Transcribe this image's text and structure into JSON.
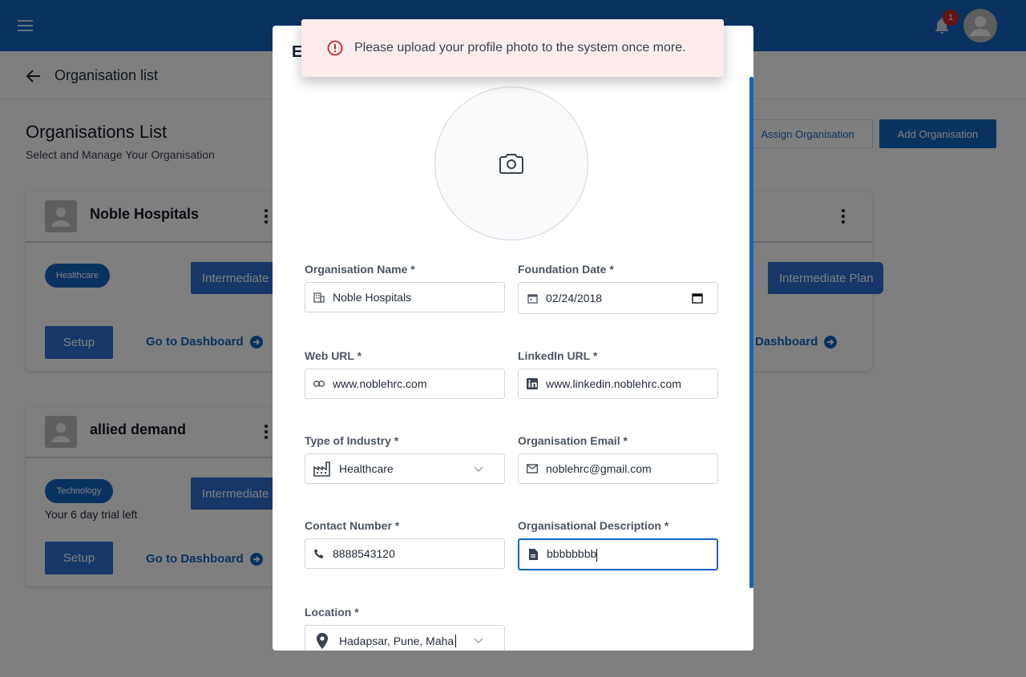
{
  "header": {
    "notification_count": "1"
  },
  "breadcrumb": {
    "label": "Organisation list"
  },
  "page": {
    "title": "Organisations List",
    "subtitle": "Select and Manage Your Organisation",
    "assign_label": "Assign Organisation",
    "add_label": "Add Organisation"
  },
  "cards": [
    {
      "name": "Noble Hospitals",
      "industry": "Healthcare",
      "plan": "Intermediate Plan",
      "setup": "Setup",
      "dashboard": "Go to Dashboard"
    },
    {
      "name": "allied demand",
      "industry": "Technology",
      "plan": "Intermediate Plan",
      "trial": "Your 6 day trial left",
      "setup": "Setup",
      "dashboard": "Go to Dashboard"
    },
    {
      "plan": "Intermediate Plan",
      "dashboard": "Dashboard"
    }
  ],
  "modal": {
    "title": "E",
    "fields": {
      "org_name": {
        "label": "Organisation Name *",
        "value": "Noble Hospitals"
      },
      "foundation_date": {
        "label": "Foundation Date *",
        "value": "02/24/2018"
      },
      "web_url": {
        "label": "Web URL *",
        "value": "www.noblehrc.com"
      },
      "linkedin_url": {
        "label": "LinkedIn URL *",
        "value": "www.linkedin.noblehrc.com"
      },
      "industry": {
        "label": "Type of Industry *",
        "value": "Healthcare"
      },
      "email": {
        "label": "Organisation Email *",
        "value": "noblehrc@gmail.com"
      },
      "contact": {
        "label": "Contact Number *",
        "value": "8888543120"
      },
      "description": {
        "label": "Organisational Description *",
        "value": "bbbbbbbb"
      },
      "location": {
        "label": "Location *",
        "value": "Hadapsar, Pune, Maha"
      }
    }
  },
  "toast": {
    "message": "Please upload your profile photo to the system once more."
  },
  "colors": {
    "primary": "#1565c0",
    "error": "#c62828",
    "toast_bg": "#fdecec"
  }
}
